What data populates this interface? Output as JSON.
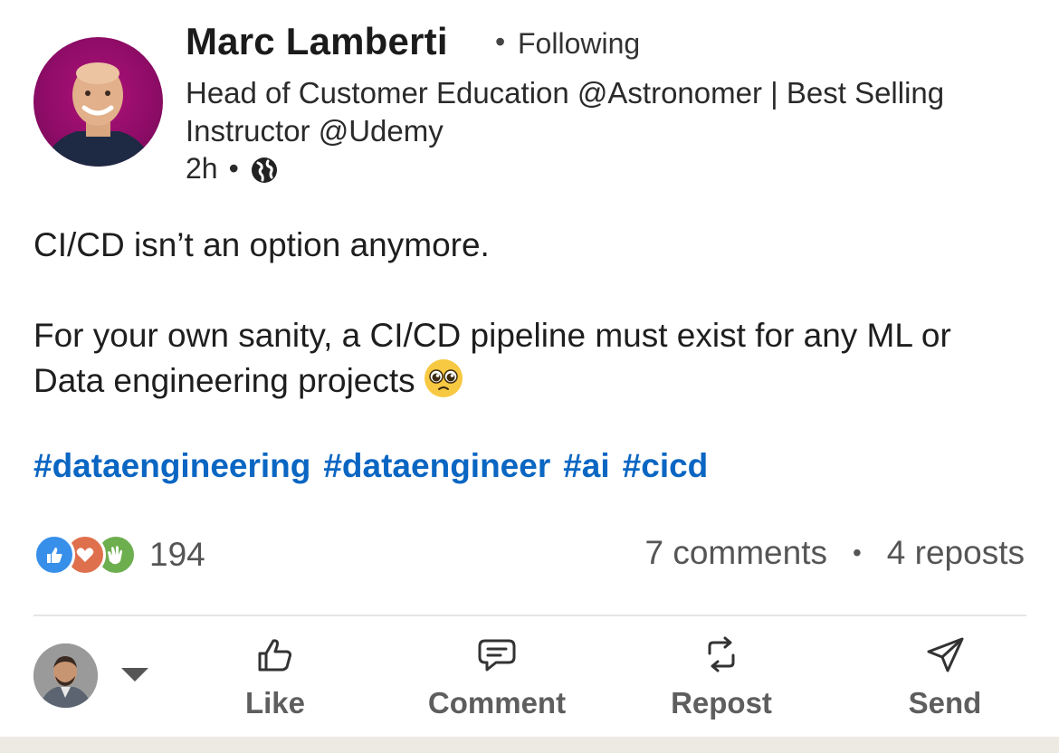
{
  "author": {
    "name": "Marc Lamberti",
    "follow_separator": "•",
    "follow_status": "Following",
    "headline": "Head of Customer Education @Astronomer | Best Selling Instructor @Udemy",
    "time": "2h",
    "meta_separator": "•",
    "visibility_icon": "globe-icon"
  },
  "post": {
    "line1": "CI/CD isn’t an option anymore.",
    "line2": "For your own sanity, a CI/CD pipeline must exist for any ML or Data engineering projects",
    "emoji": "pleading-face-emoji",
    "hashtags": [
      "#dataengineering",
      "#dataengineer",
      "#ai",
      "#cicd"
    ],
    "hashtag_color": "#0a66c2"
  },
  "engagement": {
    "reaction_icons": [
      "like-reaction-icon",
      "love-reaction-icon",
      "celebrate-reaction-icon"
    ],
    "reaction_count": "194",
    "comments": "7 comments",
    "separator": "•",
    "reposts": "4 reposts"
  },
  "actions": {
    "like": "Like",
    "comment": "Comment",
    "repost": "Repost",
    "send": "Send"
  },
  "colors": {
    "action_gray": "#5e5e5e",
    "text": "#1e1e1e",
    "divider": "#e6e6e6"
  }
}
